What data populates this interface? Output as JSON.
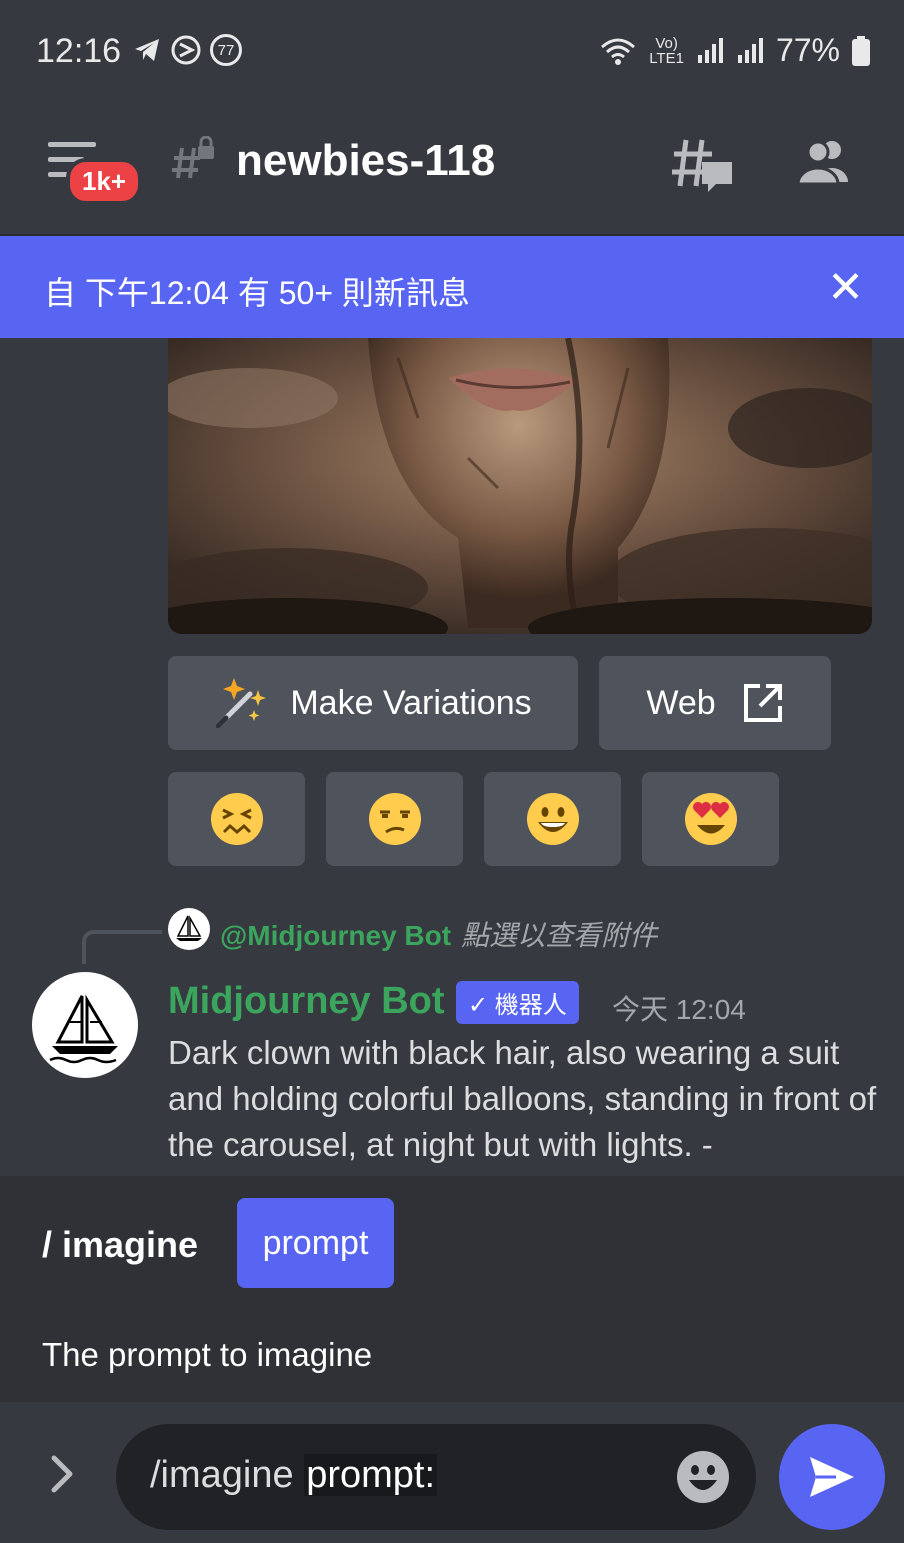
{
  "status_bar": {
    "time": "12:16",
    "notif_count": "77",
    "battery": "77%",
    "network": "LTE1"
  },
  "header": {
    "badge": "1k+",
    "channel_name": "newbies-118"
  },
  "banner": {
    "text": "自 下午12:04 有 50+ 則新訊息",
    "close_glyph": "✕"
  },
  "buttons": {
    "make_variations": "Make Variations",
    "web": "Web"
  },
  "reactions": [
    "😖",
    "😒",
    "😀",
    "😍"
  ],
  "reply": {
    "name": "@Midjourney Bot",
    "hint": "點選以查看附件"
  },
  "message": {
    "author": "Midjourney Bot",
    "bot_tag": "✓ 機器人",
    "time": "今天 12:04",
    "body": "Dark clown with black hair, also wearing a suit and holding colorful balloons, standing in front of the carousel, at night but with lights. -"
  },
  "autocomplete": {
    "command": "/ imagine",
    "option": "prompt",
    "description": "The prompt to imagine"
  },
  "composer": {
    "command": "/imagine ",
    "option": "prompt:"
  },
  "colors": {
    "background": "#36393f",
    "accent": "#5865f2",
    "bot_green": "#3ba55d",
    "badge_red": "#ed4245"
  }
}
